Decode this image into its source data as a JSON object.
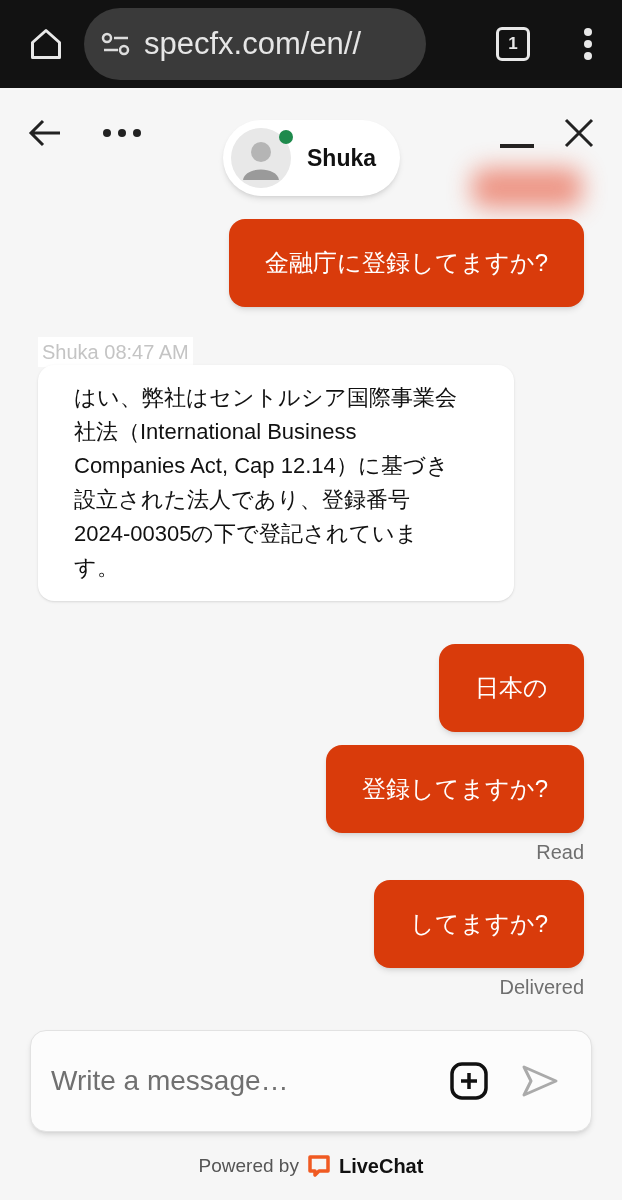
{
  "browser": {
    "url": "specfx.com/en//",
    "tab_count": "1"
  },
  "chat_header": {
    "agent_name": "Shuka",
    "online": true
  },
  "messages": [
    {
      "kind": "visitor",
      "text": "金融庁に登録してますか?"
    },
    {
      "kind": "agent",
      "meta": "Shuka 08:47 AM",
      "text": "はい、弊社はセントルシア国際事業会社法（International Business Companies Act, Cap 12.14）に基づき設立された法人であり、登録番号2024-00305の下で登記されています。"
    },
    {
      "kind": "visitor",
      "text": "日本の"
    },
    {
      "kind": "visitor",
      "text": "登録してますか?",
      "status": "Read"
    },
    {
      "kind": "visitor",
      "text": "してますか?",
      "status": "Delivered"
    }
  ],
  "composer": {
    "placeholder": "Write a message…"
  },
  "footer": {
    "powered_by": "Powered by",
    "brand": "LiveChat"
  }
}
